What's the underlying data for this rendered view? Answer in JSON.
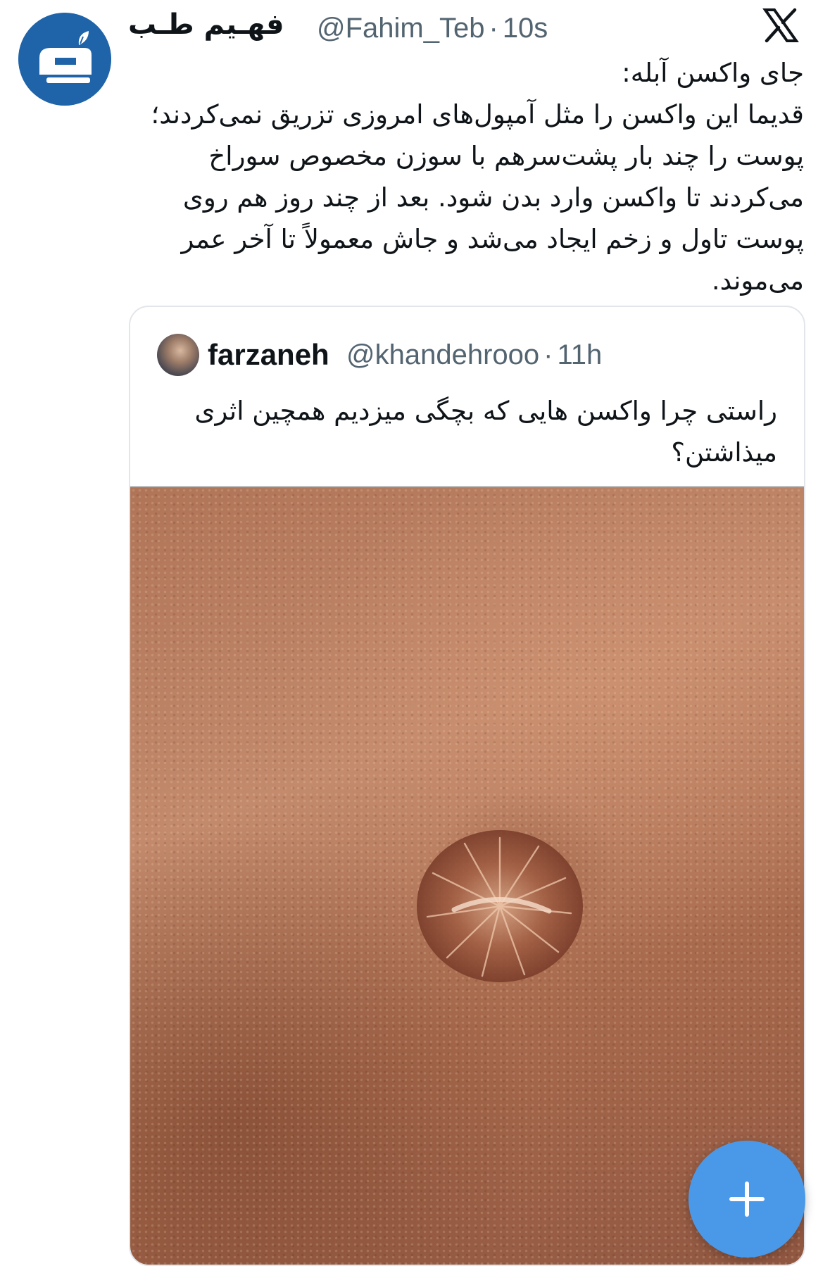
{
  "tweet": {
    "display_name": "فهـیم طـب",
    "handle": "@Fahim_Teb",
    "time": "10s",
    "text": "جای واکسن آبله:\nقدیما این واکسن را مثل آمپول‌های امروزی تزریق نمی‌کردند؛ پوست را چند بار پشت‌سرهم با سوزن مخصوص سوراخ می‌کردند تا واکسن وارد بدن شود. بعد از چند روز هم روی پوست تاول و زخم ایجاد می‌شد و جاش معمولاً تا آخر عمر می‌موند."
  },
  "quoted": {
    "display_name": "farzaneh",
    "handle": "@khandehrooo",
    "time": "11h",
    "text": "راستی چرا واکسن هایی که بچگی میزدیم همچین اثری میذاشتن؟"
  },
  "icons": {
    "avatar": "fahim-teb-logo-icon",
    "platform": "x-logo-icon",
    "compose": "plus-icon"
  },
  "colors": {
    "brand_blue": "#1f63a8",
    "fab_blue": "#4a99e9",
    "muted_text": "#536471"
  }
}
